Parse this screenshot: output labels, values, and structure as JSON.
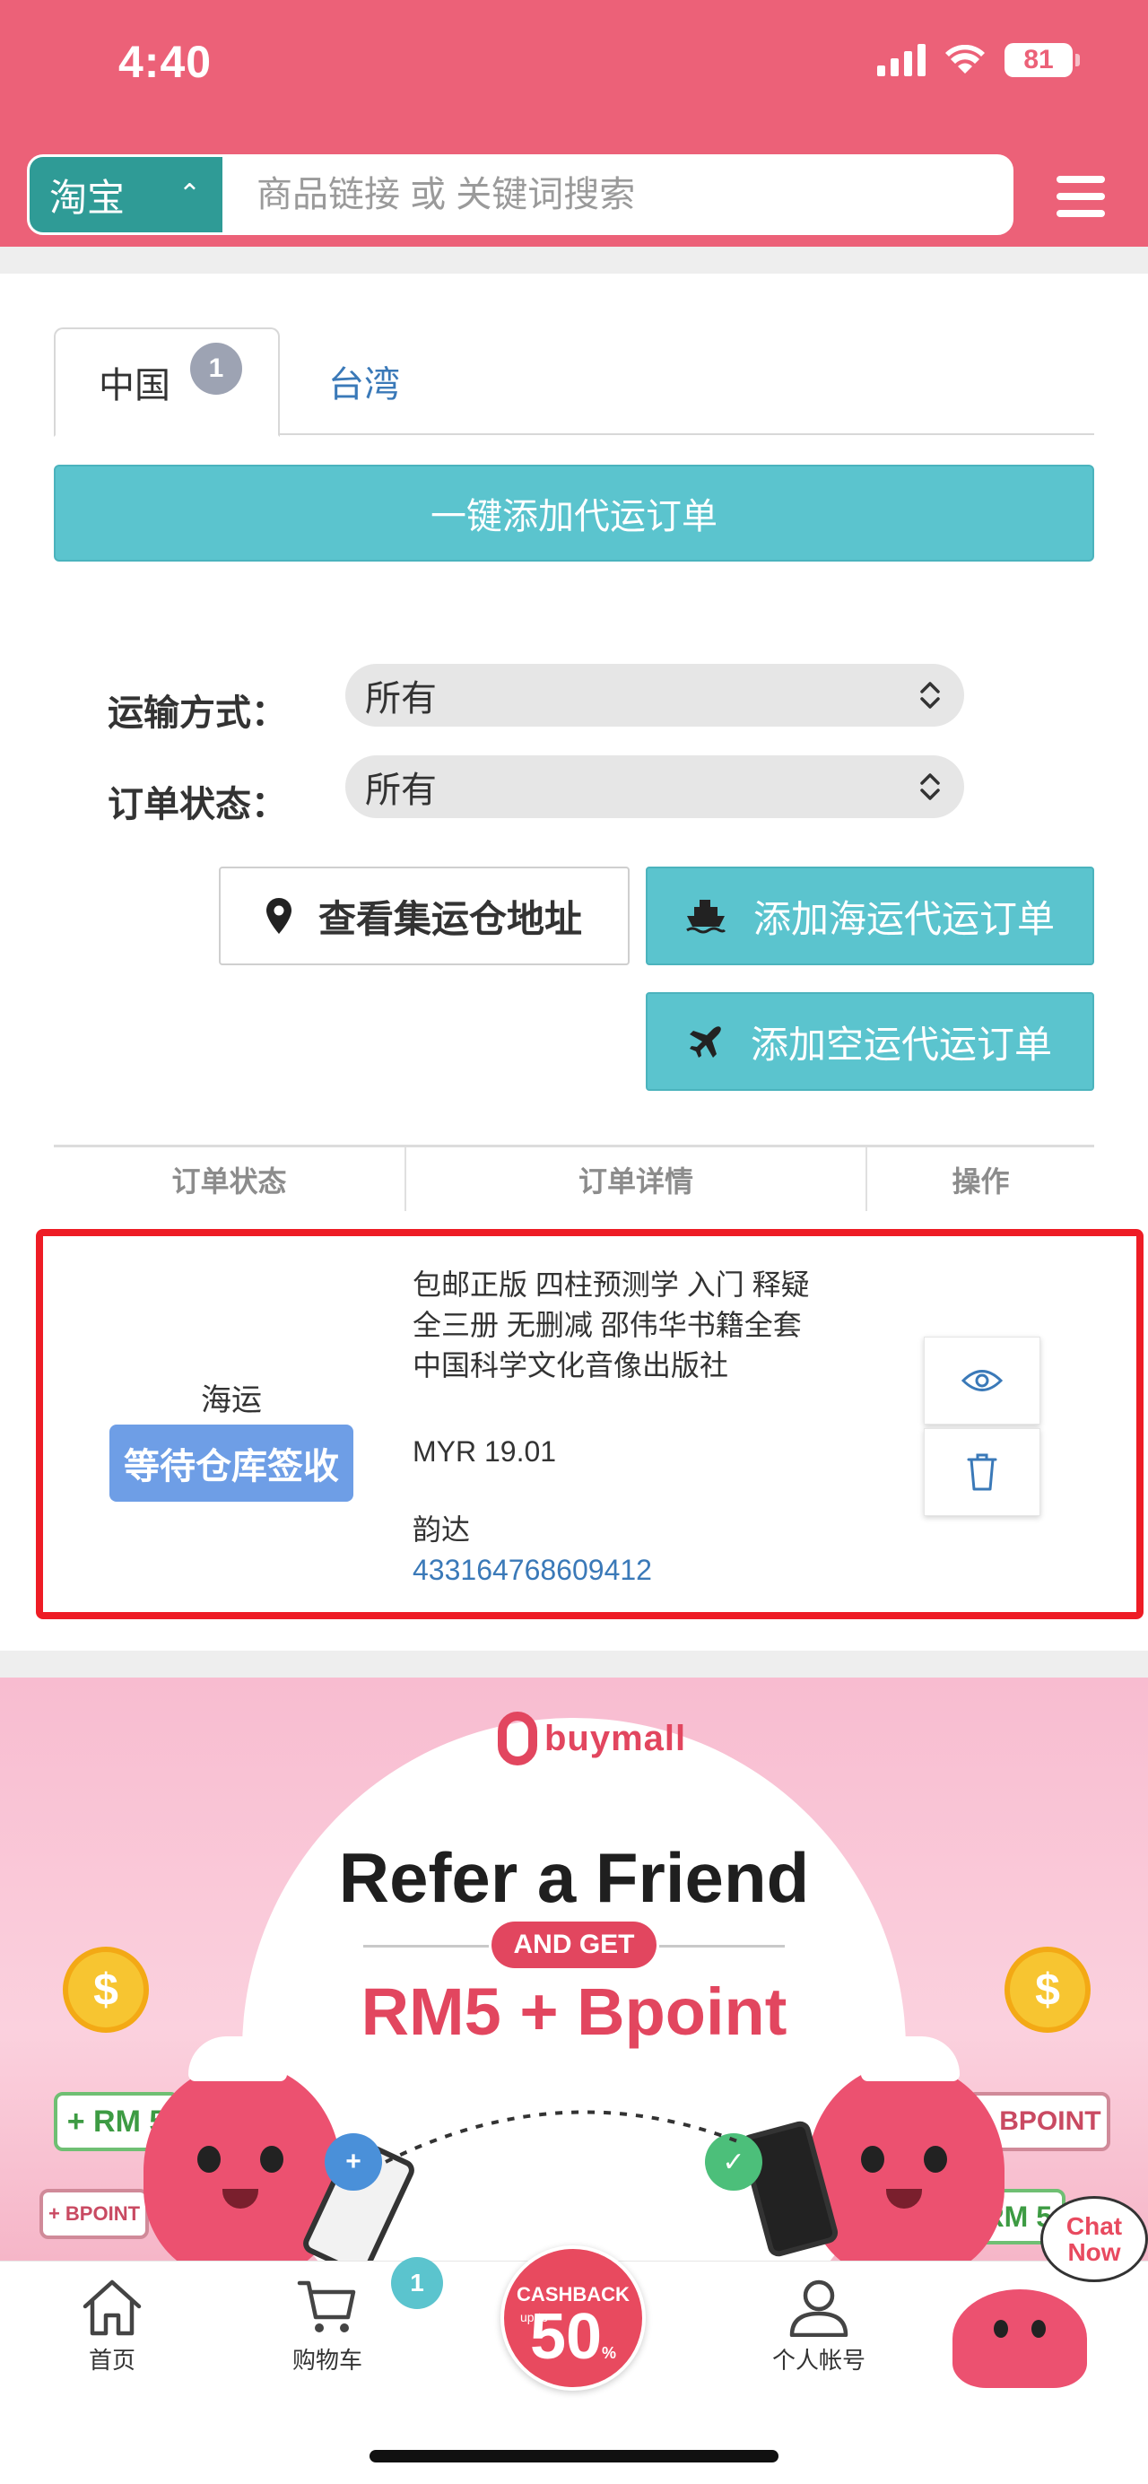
{
  "status_bar": {
    "time": "4:40",
    "battery": "81"
  },
  "search": {
    "site": "淘宝",
    "placeholder": "商品链接 或 关键词搜索"
  },
  "tabs": [
    {
      "label": "中国",
      "badge": "1",
      "active": true
    },
    {
      "label": "台湾",
      "active": false
    }
  ],
  "one_click_button": "一键添加代运订单",
  "filters": {
    "shipping_label": "运输方式：",
    "shipping_value": "所有",
    "status_label": "订单状态：",
    "status_value": "所有"
  },
  "actions": {
    "warehouse": "查看集运仓地址",
    "sea": "添加海运代运订单",
    "air": "添加空运代运订单"
  },
  "table": {
    "headers": [
      "订单状态",
      "订单详情",
      "操作"
    ],
    "rows": [
      {
        "ship_method": "海运",
        "status": "等待仓库签收",
        "title": "包邮正版 四柱预测学 入门 释疑 全三册 无删减 邵伟华书籍全套 中国科学文化音像出版社",
        "price": "MYR 19.01",
        "courier": "韵达",
        "tracking": "433164768609412"
      }
    ]
  },
  "banner": {
    "brand": "buymall",
    "title": "Refer a Friend",
    "and_get": "AND GET",
    "reward": "RM5 + Bpoint",
    "tags": {
      "rm5": "+ RM 5",
      "bpoint": "+ BPOINT"
    },
    "coin_symbol": "$"
  },
  "bottom_nav": {
    "home": "首页",
    "cart": "购物车",
    "cart_badge": "1",
    "cashback_label": "CASHBACK",
    "cashback_upto": "up to",
    "cashback_value": "50",
    "cashback_unit": "%",
    "account": "个人帐号",
    "chat_line1": "Chat",
    "chat_line2": "Now"
  },
  "colors": {
    "header": "#ec6178",
    "teal": "#5bc4ce",
    "site_select": "#2f9b96",
    "status_badge": "#6e9ee6",
    "link": "#3a79b8",
    "highlight": "#ee1c25"
  }
}
